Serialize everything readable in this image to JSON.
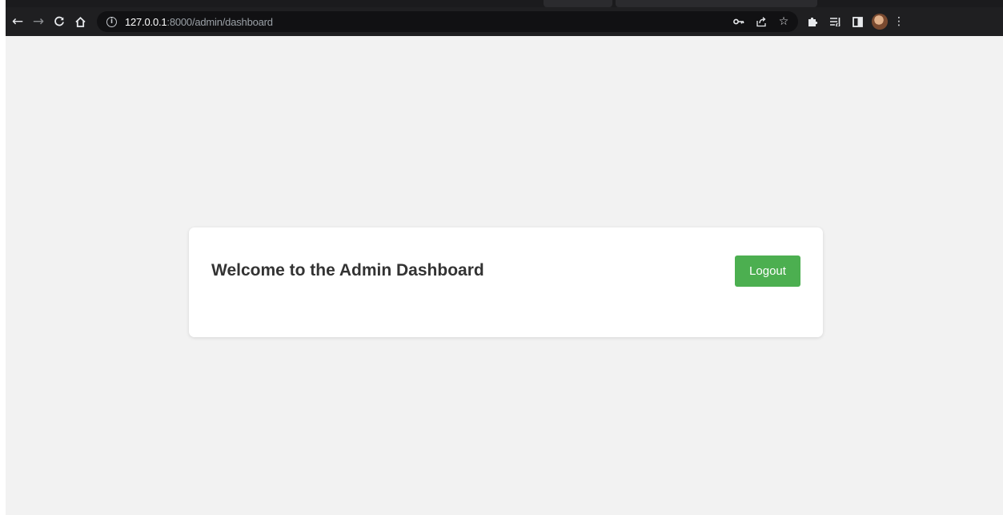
{
  "browser": {
    "url_host": "127.0.0.1",
    "url_path": ":8000/admin/dashboard",
    "icons": {
      "back": "arrow-left-icon",
      "forward": "arrow-right-icon",
      "reload": "reload-icon",
      "home": "home-icon",
      "site_info": "info-icon",
      "password": "key-icon",
      "share": "share-icon",
      "bookmark": "star-icon",
      "extensions": "puzzle-icon",
      "reading_list": "reading-list-icon",
      "side_panel": "side-panel-icon",
      "profile": "avatar",
      "menu": "kebab-menu-icon"
    }
  },
  "card": {
    "title": "Welcome to the Admin Dashboard",
    "logout_label": "Logout"
  },
  "colors": {
    "page_background": "#f2f2f2",
    "card_background": "#ffffff",
    "title_text": "#333333",
    "logout_button": "#4caf50",
    "toolbar": "#1f1f21"
  }
}
